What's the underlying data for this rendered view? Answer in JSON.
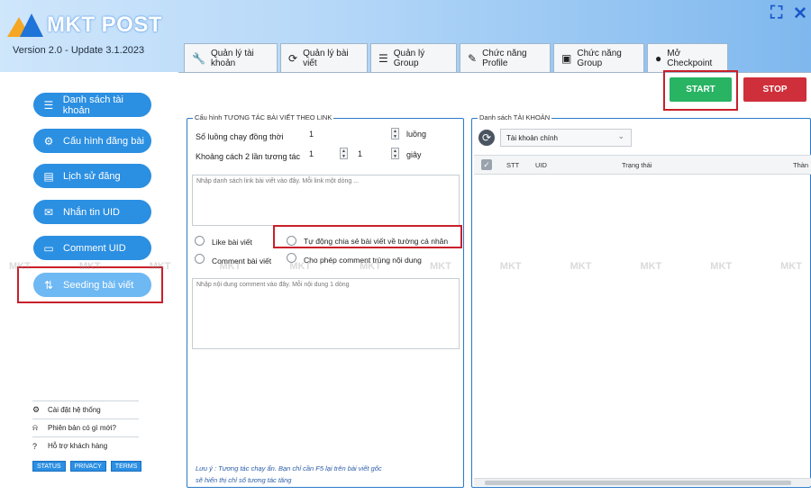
{
  "app": {
    "logo_text": "MKT POST",
    "version": "Version 2.0 - Update 3.1.2023",
    "maximize_icon": "expand-icon",
    "close_icon": "close-icon"
  },
  "tabs": [
    {
      "label": "Quản lý tài khoản",
      "icon": "wrench-icon"
    },
    {
      "label": "Quản lý bài viết",
      "icon": "refresh-icon"
    },
    {
      "label": "Quản lý Group",
      "icon": "list-icon"
    },
    {
      "label": "Chức năng Profile",
      "icon": "pen-icon"
    },
    {
      "label": "Chức năng Group",
      "icon": "window-icon"
    },
    {
      "label": "Mở Checkpoint",
      "icon": "user-icon"
    }
  ],
  "toolbar": {
    "start_label": "START",
    "stop_label": "STOP",
    "start_color": "#28b463",
    "stop_color": "#cf2f3a"
  },
  "sidebar": {
    "items": [
      {
        "label": "Danh sách tài khoản",
        "icon": "list-icon"
      },
      {
        "label": "Cấu hình đăng bài",
        "icon": "gears-icon"
      },
      {
        "label": "Lịch sử đăng",
        "icon": "history-icon"
      },
      {
        "label": "Nhắn tin UID",
        "icon": "message-icon"
      },
      {
        "label": "Comment UID",
        "icon": "comment-icon"
      },
      {
        "label": "Seeding bài viết",
        "icon": "seeding-icon",
        "active": true
      }
    ],
    "links": [
      {
        "label": "Cài đặt hệ thống",
        "icon": "gear-icon"
      },
      {
        "label": "Phiên bản có gì mới?",
        "icon": "bell-icon"
      },
      {
        "label": "Hỗ trợ khách hàng",
        "icon": "help-icon"
      }
    ],
    "badges": [
      "STATUS",
      "PRIVACY",
      "TERMS"
    ]
  },
  "config": {
    "title": "Cấu hình TƯƠNG TÁC BÀI VIẾT THEO LINK",
    "threads_label": "Số luồng chạy đồng thời",
    "threads_value": "1",
    "threads_unit": "luồng",
    "interval_label": "Khoảng cách 2 lần tương tác",
    "interval_min": "1",
    "interval_max": "1",
    "interval_unit": "giây",
    "links_placeholder": "Nhập danh sách link bài viết vào đây. Mỗi link một dòng ...",
    "like_label": "Like bài viết",
    "share_label": "Tự động chia sẻ bài viết về tường cá nhân",
    "comment_label": "Comment bài viết",
    "duplicate_label": "Cho phép comment trùng nội dung",
    "comment_placeholder": "Nhập nội dung comment vào đây. Mỗi nội dung 1 dòng",
    "note_line1": "Lưu ý : Tương tác chạy ẩn. Bạn chỉ cần F5 lại trên bài viết gốc",
    "note_line2": "sẽ hiển thị chỉ số tương tác tăng"
  },
  "accounts": {
    "title": "Danh sách TÀI KHOẢN",
    "account_select": "Tài khoản chính",
    "columns": [
      "STT",
      "UID",
      "Trạng thái",
      "Thàn"
    ]
  },
  "watermark": "MKT"
}
